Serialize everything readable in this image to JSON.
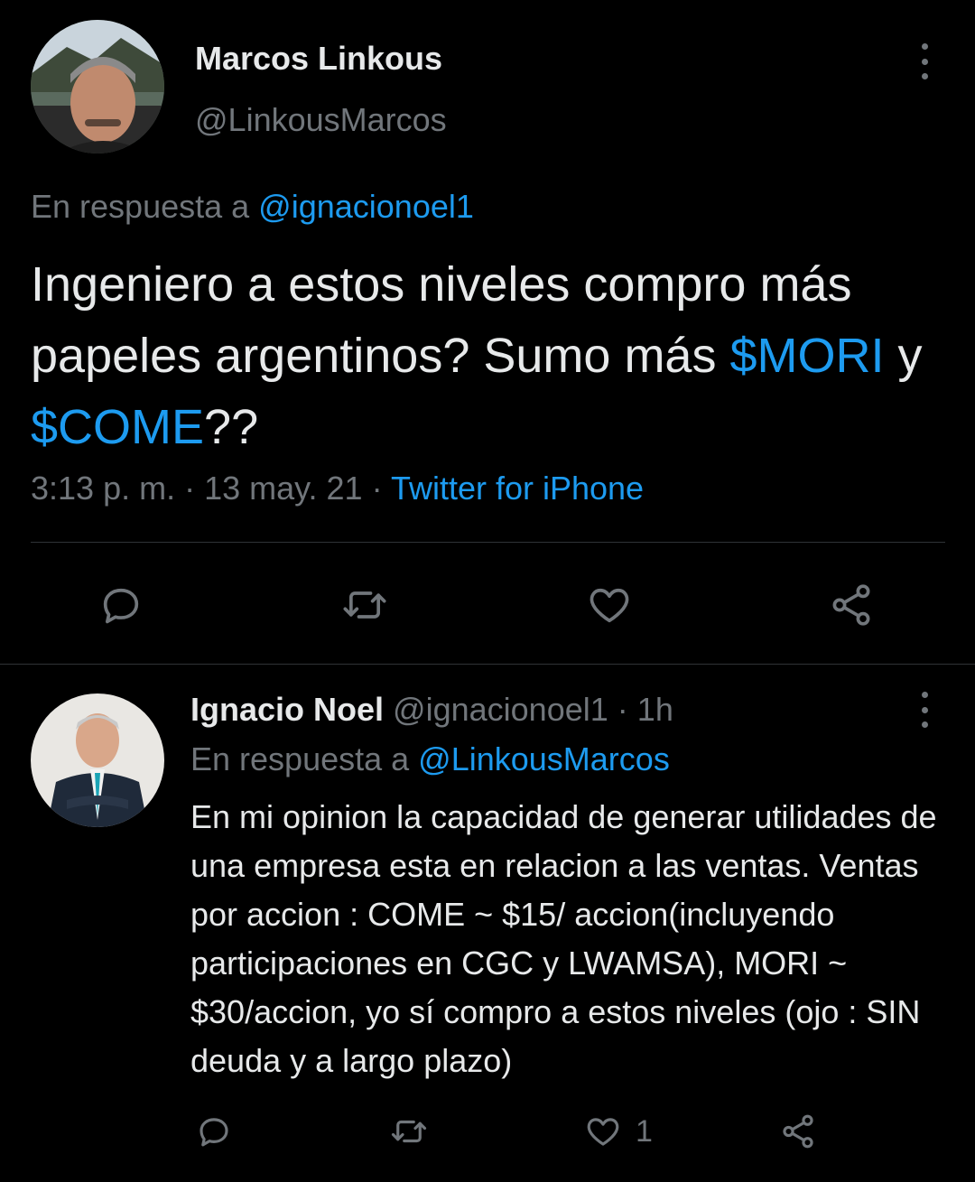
{
  "colors": {
    "accent": "#1d9bf0",
    "muted": "#71767b",
    "text": "#d9d9d9",
    "background": "#000000",
    "divider": "#2f3336"
  },
  "main_tweet": {
    "author_name": "Marcos Linkous",
    "author_handle": "@LinkousMarcos",
    "reply_prefix": "En respuesta a",
    "reply_to": "@ignacionoel1",
    "text_part1": "Ingeniero a estos niveles compro más papeles argentinos? Sumo más",
    "cashtag1": "$MORI",
    "text_join": "y",
    "cashtag2": "$COME",
    "text_end": "??",
    "time": "3:13 p. m.",
    "date": "13 may. 21",
    "separator": "·",
    "source": "Twitter for iPhone",
    "icons": [
      "reply-icon",
      "retweet-icon",
      "like-icon",
      "share-icon"
    ]
  },
  "reply_tweet": {
    "author_name": "Ignacio Noel",
    "author_handle": "@ignacionoel1",
    "time_ago": "1h",
    "separator": "·",
    "reply_prefix": "En respuesta a",
    "reply_to": "@LinkousMarcos",
    "text": "En mi opinion la capacidad de generar utilidades de una empresa esta en relacion a las ventas. Ventas por accion : COME ~ $15/ accion(incluyendo participaciones en CGC y LWAMSA), MORI ~ $30/accion, yo sí compro a estos niveles (ojo : SIN deuda y a largo plazo)",
    "like_count": "1",
    "icons": [
      "reply-icon",
      "retweet-icon",
      "like-icon",
      "share-icon"
    ]
  }
}
